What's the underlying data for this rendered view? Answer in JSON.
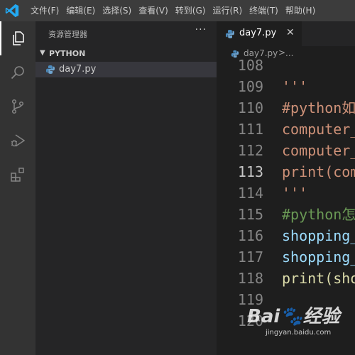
{
  "colors": {
    "titlebar": "#3c3c3c",
    "activitybar": "#333333",
    "sidebar": "#252526",
    "editor": "#1e1e1e",
    "accent_logo": "#23a9f2",
    "string": "#ce9178",
    "comment": "#6a9955",
    "variable": "#9cdcfe",
    "function": "#dcdcaa"
  },
  "menu": [
    "文件(F)",
    "编辑(E)",
    "选择(S)",
    "查看(V)",
    "转到(G)",
    "运行(R)",
    "终端(T)",
    "帮助(H)"
  ],
  "activity_icons": [
    "explorer-icon",
    "search-icon",
    "source-control-icon",
    "run-debug-icon",
    "extensions-icon"
  ],
  "sidebar": {
    "title": "资源管理器",
    "more": "···",
    "section": "PYTHON",
    "files": [
      {
        "name": "day7.py",
        "icon": "python-file-icon"
      }
    ]
  },
  "tab": {
    "name": "day7.py",
    "close": "✕"
  },
  "breadcrumb": {
    "file": "day7.py",
    "sep": ">",
    "more": "..."
  },
  "editor": {
    "current_line": "113",
    "lines": [
      {
        "num": "108",
        "text": ""
      },
      {
        "num": "109",
        "text": "'''"
      },
      {
        "num": "110",
        "text": "#python如"
      },
      {
        "num": "111",
        "text": "computer_"
      },
      {
        "num": "112",
        "text": "computer_"
      },
      {
        "num": "113",
        "text": "print(com"
      },
      {
        "num": "114",
        "text": "'''"
      },
      {
        "num": "115",
        "text": "#python怎"
      },
      {
        "num": "116",
        "text": "shopping_"
      },
      {
        "num": "117",
        "text": "shopping_"
      },
      {
        "num": "118",
        "text": "print(sho"
      },
      {
        "num": "119",
        "text": ""
      },
      {
        "num": "120",
        "text": ""
      }
    ]
  },
  "watermark": {
    "brand": "Bai🐾经验",
    "url": "jingyan.baidu.com"
  }
}
